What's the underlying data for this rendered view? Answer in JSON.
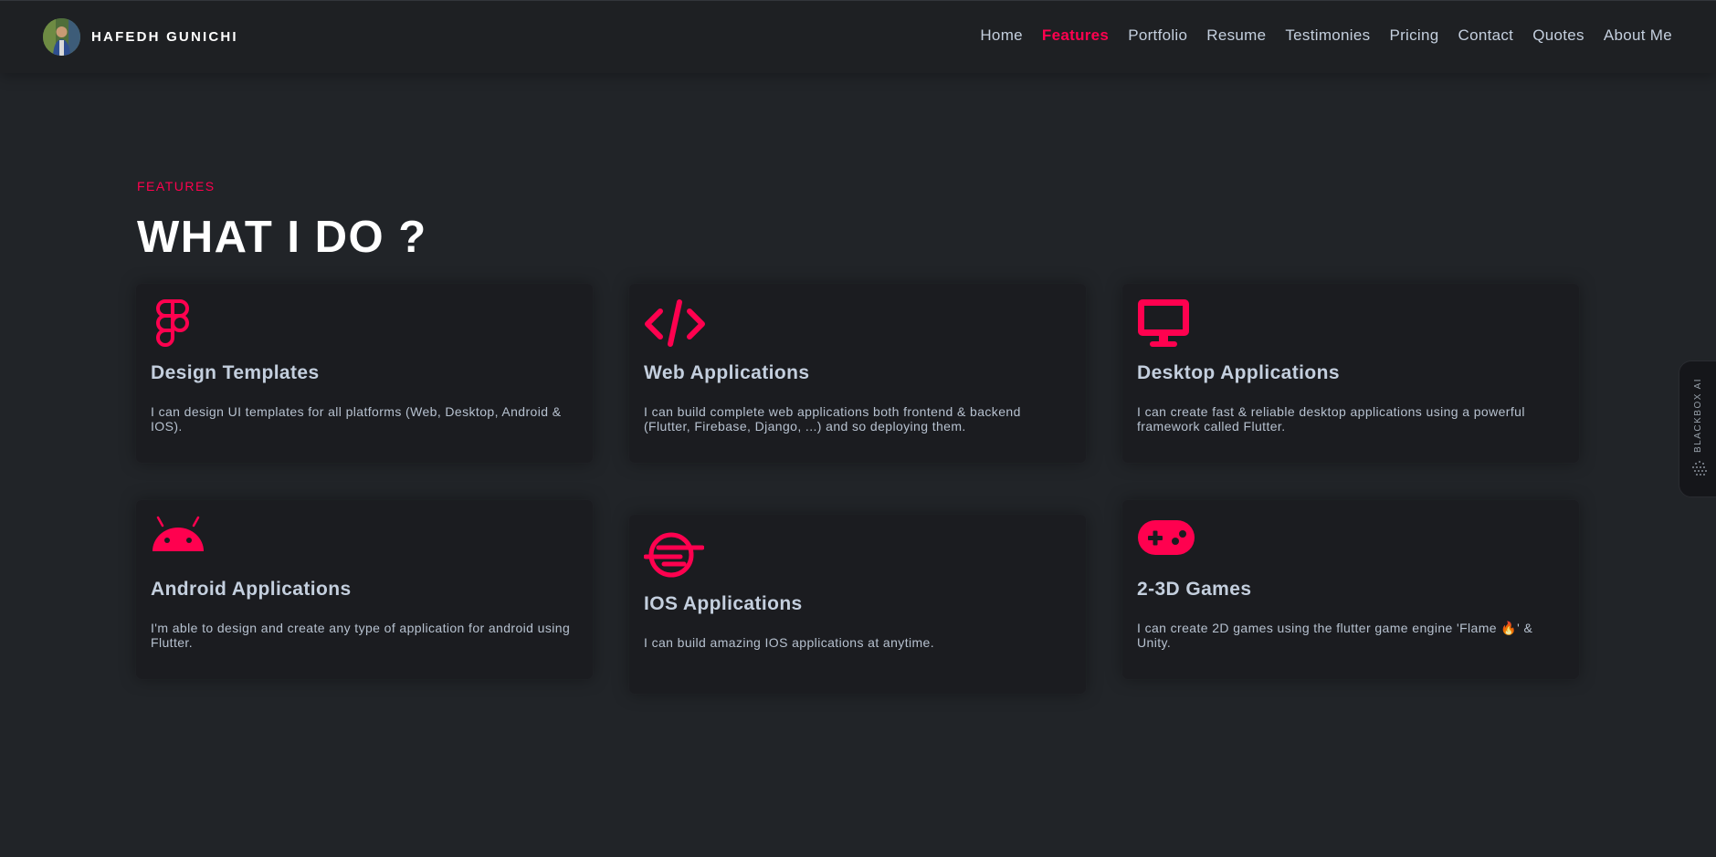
{
  "header": {
    "brand_name": "HAFEDH GUNICHI",
    "nav": [
      {
        "label": "Home",
        "active": false
      },
      {
        "label": "Features",
        "active": true
      },
      {
        "label": "Portfolio",
        "active": false
      },
      {
        "label": "Resume",
        "active": false
      },
      {
        "label": "Testimonies",
        "active": false
      },
      {
        "label": "Pricing",
        "active": false
      },
      {
        "label": "Contact",
        "active": false
      },
      {
        "label": "Quotes",
        "active": false
      },
      {
        "label": "About Me",
        "active": false
      }
    ]
  },
  "section": {
    "subtitle": "FEATURES",
    "title": "WHAT I DO ?"
  },
  "cards": [
    {
      "icon": "figma-icon",
      "title": "Design Templates",
      "description": "I can design UI templates for all platforms (Web, Desktop, Android & IOS)."
    },
    {
      "icon": "code-icon",
      "title": "Web Applications",
      "description": "I can build complete web applications both frontend & backend (Flutter, Firebase, Django, ...) and so deploying them."
    },
    {
      "icon": "desktop-icon",
      "title": "Desktop Applications",
      "description": "I can create fast & reliable desktop applications using a powerful framework called Flutter."
    },
    {
      "icon": "android-icon",
      "title": "Android Applications",
      "description": "I'm able to design and create any type of application for android using Flutter."
    },
    {
      "icon": "ios-icon",
      "title": "IOS Applications",
      "description": "I can build amazing IOS applications at anytime."
    },
    {
      "icon": "gamepad-icon",
      "title": "2-3D Games",
      "description": "I can create 2D games using the flutter game engine 'Flame 🔥' & Unity."
    }
  ],
  "side_widget": {
    "label": "BLACKBOX AI"
  },
  "colors": {
    "accent": "#ff014f",
    "background": "#212428",
    "card": "#1b1c20",
    "text": "#c4cfde"
  }
}
